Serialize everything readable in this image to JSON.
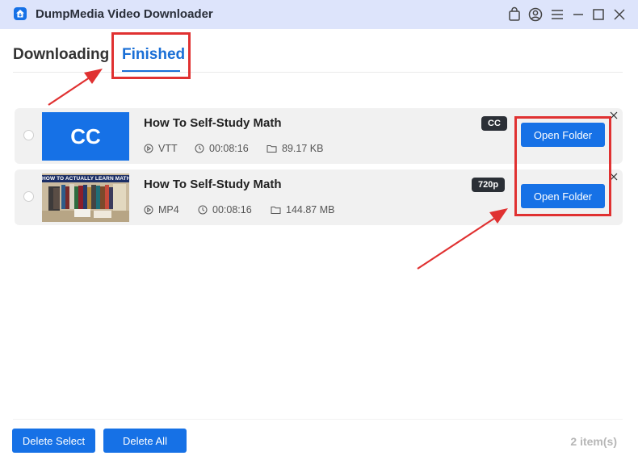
{
  "window": {
    "title": "DumpMedia Video Downloader",
    "controls": [
      "cart-icon",
      "account-icon",
      "menu-icon",
      "minimize-icon",
      "maximize-icon",
      "close-icon"
    ]
  },
  "tabs": [
    {
      "label": "Downloading",
      "active": false
    },
    {
      "label": "Finished",
      "active": true
    }
  ],
  "items": [
    {
      "title": "How To Self-Study Math",
      "thumbnail_text": "CC",
      "badge": "CC",
      "format": "VTT",
      "duration": "00:08:16",
      "size": "89.17 KB",
      "action": "Open Folder"
    },
    {
      "title": "How To Self-Study Math",
      "thumbnail_text": "HOW TO ACTUALLY LEARN MATH",
      "badge": "720p",
      "format": "MP4",
      "duration": "00:08:16",
      "size": "144.87 MB",
      "action": "Open Folder"
    }
  ],
  "footer": {
    "delete_select": "Delete Select",
    "delete_all": "Delete All",
    "count": "2 item(s)"
  },
  "colors": {
    "accent": "#1671e6",
    "annotation": "#e03131",
    "titlebar": "#dde4fb"
  }
}
